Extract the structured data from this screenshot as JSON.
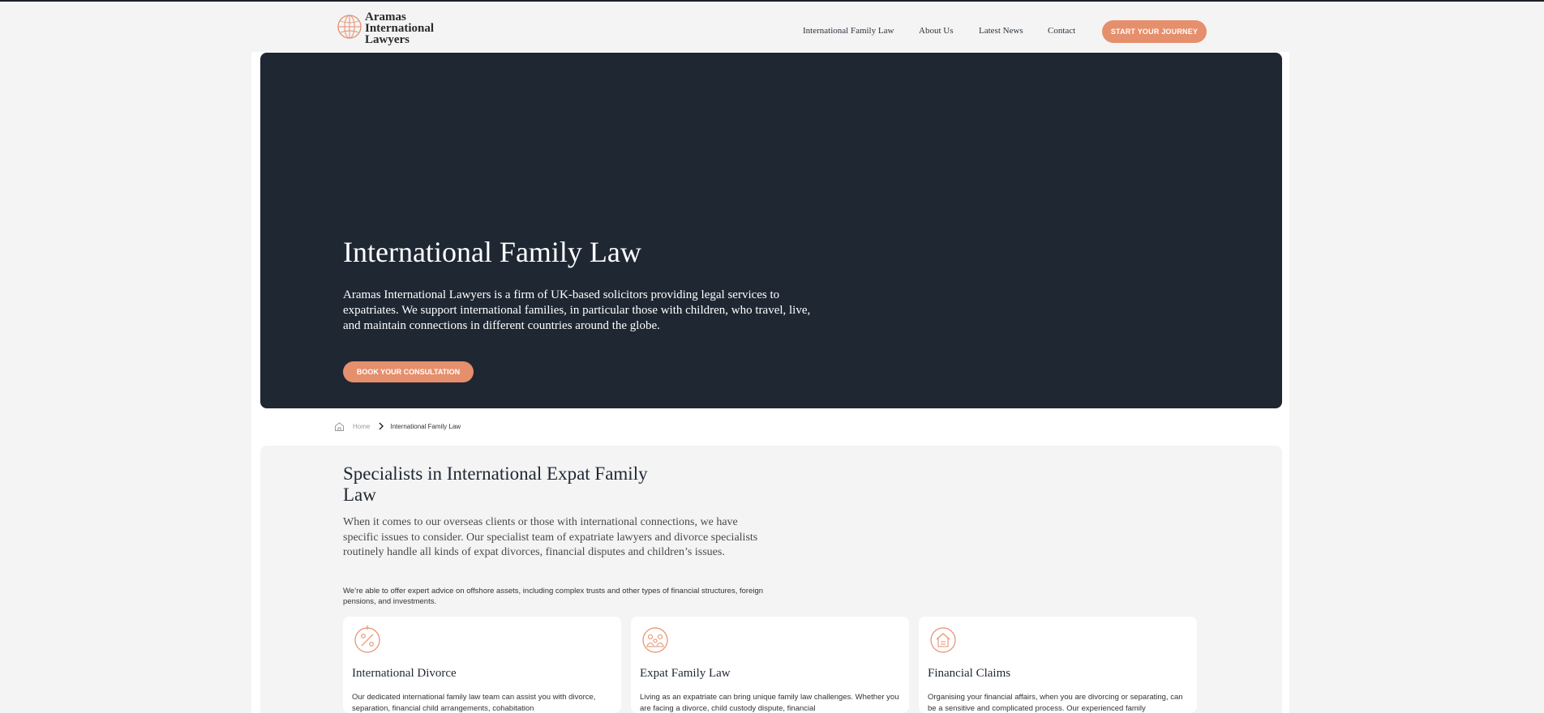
{
  "header": {
    "logo_lines": [
      "Aramas",
      "International",
      "Lawyers"
    ],
    "nav": [
      {
        "label": "International Family Law"
      },
      {
        "label": "About Us"
      },
      {
        "label": "Latest News"
      },
      {
        "label": "Contact"
      }
    ],
    "cta_label": "START YOUR JOURNEY"
  },
  "hero": {
    "title": "International Family Law",
    "text": "Aramas International Lawyers is a firm of UK-based solicitors providing legal services to expatriates. We support international families, in particular those with children, who travel, live, and maintain connections in different countries around the globe.",
    "button_label": "BOOK YOUR CONSULTATION"
  },
  "breadcrumb": {
    "home": "Home",
    "current": "International Family Law"
  },
  "section": {
    "title": "Specialists in International Expat Family Law",
    "lead": "When it comes to our overseas clients or those with international connections, we have specific issues to consider. Our specialist team of expatriate lawyers and divorce specialists routinely handle all kinds of expat divorces, financial disputes and children’s issues.",
    "note": "We’re able to offer expert advice on offshore assets, including complex trusts and other types of financial structures, foreign pensions, and investments."
  },
  "cards": [
    {
      "icon": "percent-badge-icon",
      "title": "International Divorce",
      "text": "Our dedicated international family law team can assist you with divorce, separation, financial child arrangements, cohabitation"
    },
    {
      "icon": "family-icon",
      "title": "Expat Family Law",
      "text": "Living as an expatriate can bring unique family law challenges. Whether you are facing a divorce, child custody dispute, financial"
    },
    {
      "icon": "house-document-icon",
      "title": "Financial Claims",
      "text": "Organising your financial affairs, when you are divorcing or separating, can be a sensitive and complicated process. Our experienced family"
    }
  ],
  "colors": {
    "accent": "#e58f6c",
    "dark": "#1f2733",
    "background": "#f4f4f4"
  }
}
